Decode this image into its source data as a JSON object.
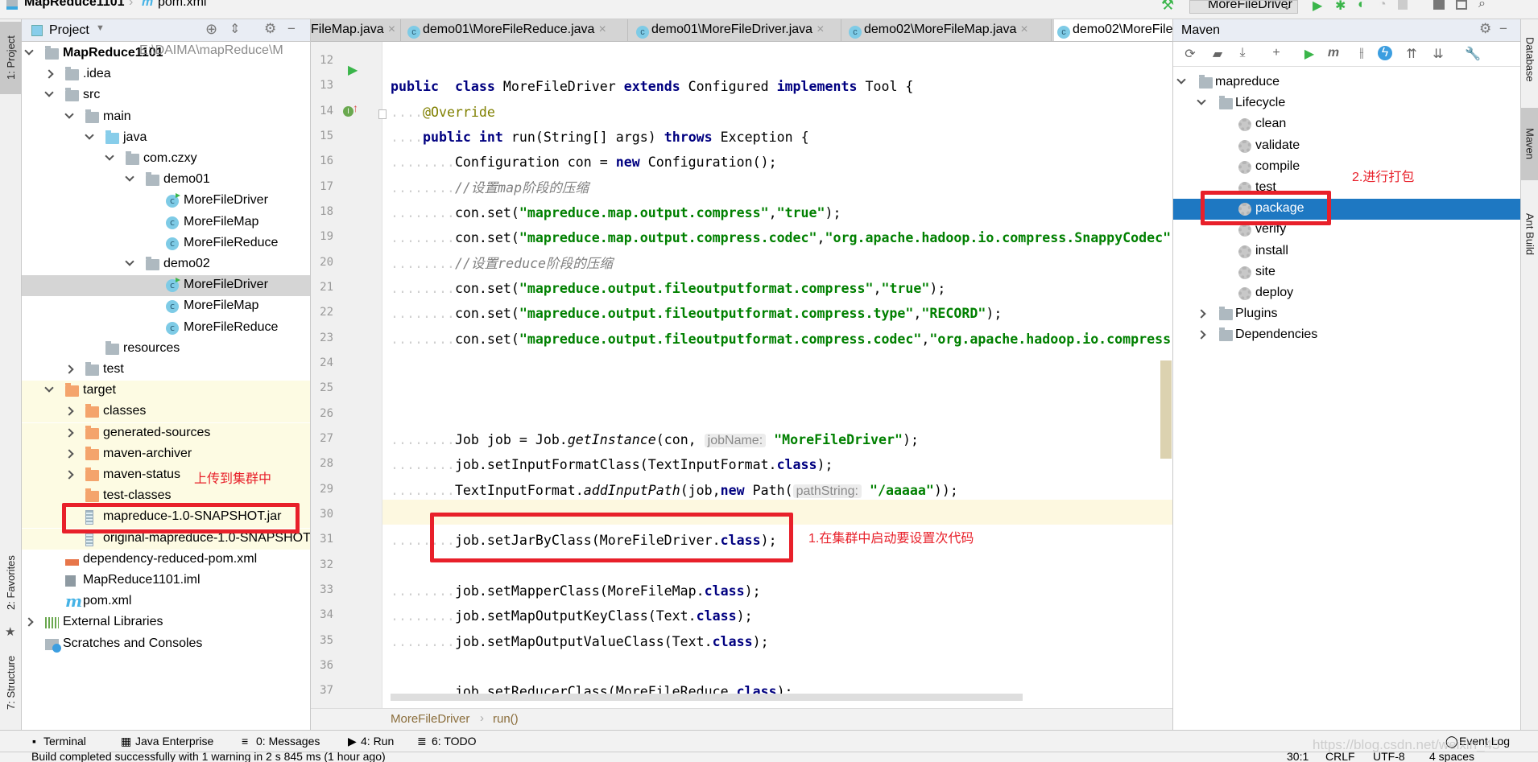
{
  "window": {
    "project": "MapReduce1101",
    "file": "pom.xml"
  },
  "toolbar": {
    "run_config": "MoreFileDriver"
  },
  "left_stripe": {
    "project": "1: Project",
    "favorites": "2: Favorites",
    "structure": "7: Structure"
  },
  "right_stripe": {
    "database": "Database",
    "maven": "Maven",
    "ant": "Ant Build"
  },
  "project": {
    "title": "Project",
    "root_path": "E:\\DAIMA\\mapReduce\\M",
    "tree": [
      {
        "label": "MapReduce1101",
        "level": 0,
        "state": "open",
        "icon": "module",
        "bold": true
      },
      {
        "label": ".idea",
        "level": 1,
        "state": "closed",
        "icon": "folder"
      },
      {
        "label": "src",
        "level": 1,
        "state": "open",
        "icon": "folder"
      },
      {
        "label": "main",
        "level": 2,
        "state": "open",
        "icon": "folder"
      },
      {
        "label": "java",
        "level": 3,
        "state": "open",
        "icon": "source-folder"
      },
      {
        "label": "com.czxy",
        "level": 4,
        "state": "open",
        "icon": "package"
      },
      {
        "label": "demo01",
        "level": 5,
        "state": "open",
        "icon": "package"
      },
      {
        "label": "MoreFileDriver",
        "level": 6,
        "icon": "class-runnable"
      },
      {
        "label": "MoreFileMap",
        "level": 6,
        "icon": "class"
      },
      {
        "label": "MoreFileReduce",
        "level": 6,
        "icon": "class"
      },
      {
        "label": "demo02",
        "level": 5,
        "state": "open",
        "icon": "package"
      },
      {
        "label": "MoreFileDriver",
        "level": 6,
        "icon": "class-runnable",
        "selected": true
      },
      {
        "label": "MoreFileMap",
        "level": 6,
        "icon": "class"
      },
      {
        "label": "MoreFileReduce",
        "level": 6,
        "icon": "class"
      },
      {
        "label": "resources",
        "level": 3,
        "icon": "resources-folder"
      },
      {
        "label": "test",
        "level": 2,
        "state": "closed",
        "icon": "folder"
      },
      {
        "label": "target",
        "level": 1,
        "state": "open",
        "icon": "excluded-folder",
        "band": true
      },
      {
        "label": "classes",
        "level": 2,
        "state": "closed",
        "icon": "excluded-folder",
        "band": true
      },
      {
        "label": "generated-sources",
        "level": 2,
        "state": "closed",
        "icon": "excluded-folder",
        "band": true
      },
      {
        "label": "maven-archiver",
        "level": 2,
        "state": "closed",
        "icon": "excluded-folder",
        "band": true
      },
      {
        "label": "maven-status",
        "level": 2,
        "state": "closed",
        "icon": "excluded-folder",
        "band": true
      },
      {
        "label": "test-classes",
        "level": 2,
        "icon": "excluded-folder",
        "band": true
      },
      {
        "label": "mapreduce-1.0-SNAPSHOT.jar",
        "level": 2,
        "icon": "jar",
        "band": true
      },
      {
        "label": "original-mapreduce-1.0-SNAPSHOT.jar",
        "level": 2,
        "icon": "jar",
        "band": true
      },
      {
        "label": "dependency-reduced-pom.xml",
        "level": 1,
        "icon": "xml"
      },
      {
        "label": "MapReduce1101.iml",
        "level": 1,
        "icon": "iml"
      },
      {
        "label": "pom.xml",
        "level": 1,
        "icon": "maven-pom"
      },
      {
        "label": "External Libraries",
        "level": 0,
        "state": "closed",
        "icon": "libraries"
      },
      {
        "label": "Scratches and Consoles",
        "level": 0,
        "icon": "scratches"
      }
    ]
  },
  "tabs": [
    {
      "label": "FileMap.java",
      "icon": "class"
    },
    {
      "label": "demo01\\MoreFileReduce.java",
      "icon": "class"
    },
    {
      "label": "demo01\\MoreFileDriver.java",
      "icon": "class-runnable"
    },
    {
      "label": "demo02\\MoreFileMap.java",
      "icon": "class"
    },
    {
      "label": "demo02\\MoreFileDriver.java",
      "icon": "class-runnable",
      "active": true
    }
  ],
  "editor": {
    "caret_line": 30,
    "lines": [
      {
        "n": "12",
        "indent": 0,
        "tokens": []
      },
      {
        "n": "13",
        "indent": 0,
        "tokens": [
          [
            "kw",
            "public"
          ],
          [
            "",
            "  "
          ],
          [
            "kw",
            "class"
          ],
          [
            "",
            " MoreFileDriver "
          ],
          [
            "kw",
            "extends"
          ],
          [
            "",
            " Configured "
          ],
          [
            "kw",
            "implements"
          ],
          [
            "",
            " Tool {"
          ]
        ]
      },
      {
        "n": "14",
        "indent": 4,
        "tokens": [
          [
            "ann",
            "@Override"
          ]
        ]
      },
      {
        "n": "15",
        "indent": 4,
        "tokens": [
          [
            "kw",
            "public"
          ],
          [
            "",
            " "
          ],
          [
            "kw",
            "int"
          ],
          [
            "",
            " run(String[] args) "
          ],
          [
            "kw",
            "throws"
          ],
          [
            "",
            " Exception {"
          ]
        ]
      },
      {
        "n": "16",
        "indent": 8,
        "tokens": [
          [
            "",
            "Configuration con = "
          ],
          [
            "kw",
            "new"
          ],
          [
            "",
            " Configuration();"
          ]
        ]
      },
      {
        "n": "17",
        "indent": 8,
        "tokens": [
          [
            "cm",
            "//设置map阶段的压缩"
          ]
        ]
      },
      {
        "n": "18",
        "indent": 8,
        "tokens": [
          [
            "",
            "con.set("
          ],
          [
            "str",
            "\"mapreduce.map.output.compress\""
          ],
          [
            "",
            ","
          ],
          [
            "str",
            "\"true\""
          ],
          [
            "",
            ");"
          ]
        ]
      },
      {
        "n": "19",
        "indent": 8,
        "tokens": [
          [
            "",
            "con.set("
          ],
          [
            "str",
            "\"mapreduce.map.output.compress.codec\""
          ],
          [
            "",
            ","
          ],
          [
            "str",
            "\"org.apache.hadoop.io.compress.SnappyCodec\""
          ],
          [
            "",
            ");"
          ]
        ]
      },
      {
        "n": "20",
        "indent": 8,
        "tokens": [
          [
            "cm",
            "//设置reduce阶段的压缩"
          ]
        ]
      },
      {
        "n": "21",
        "indent": 8,
        "tokens": [
          [
            "",
            "con.set("
          ],
          [
            "str",
            "\"mapreduce.output.fileoutputformat.compress\""
          ],
          [
            "",
            ","
          ],
          [
            "str",
            "\"true\""
          ],
          [
            "",
            ");"
          ]
        ]
      },
      {
        "n": "22",
        "indent": 8,
        "tokens": [
          [
            "",
            "con.set("
          ],
          [
            "str",
            "\"mapreduce.output.fileoutputformat.compress.type\""
          ],
          [
            "",
            ","
          ],
          [
            "str",
            "\"RECORD\""
          ],
          [
            "",
            ");"
          ]
        ]
      },
      {
        "n": "23",
        "indent": 8,
        "tokens": [
          [
            "",
            "con.set("
          ],
          [
            "str",
            "\"mapreduce.output.fileoutputformat.compress.codec\""
          ],
          [
            "",
            ","
          ],
          [
            "str",
            "\"org.apache.hadoop.io.compress"
          ]
        ]
      },
      {
        "n": "24",
        "indent": 0,
        "tokens": []
      },
      {
        "n": "25",
        "indent": 0,
        "tokens": []
      },
      {
        "n": "26",
        "indent": 0,
        "tokens": []
      },
      {
        "n": "27",
        "indent": 8,
        "tokens": [
          [
            "",
            "Job job = Job."
          ],
          [
            "it",
            "getInstance"
          ],
          [
            "",
            "(con, "
          ],
          [
            "hint",
            "jobName:"
          ],
          [
            "str",
            "\"MoreFileDriver\""
          ],
          [
            "",
            ");"
          ]
        ]
      },
      {
        "n": "28",
        "indent": 8,
        "tokens": [
          [
            "",
            "job.setInputFormatClass(TextInputFormat."
          ],
          [
            "kw",
            "class"
          ],
          [
            "",
            ");"
          ]
        ]
      },
      {
        "n": "29",
        "indent": 8,
        "tokens": [
          [
            "",
            "TextInputFormat."
          ],
          [
            "it",
            "addInputPath"
          ],
          [
            "",
            "(job,"
          ],
          [
            "kw",
            "new"
          ],
          [
            "",
            " Path("
          ],
          [
            "hint",
            "pathString:"
          ],
          [
            "str",
            "\"/aaaaa\""
          ],
          [
            "",
            "));"
          ]
        ]
      },
      {
        "n": "30",
        "indent": 0,
        "tokens": []
      },
      {
        "n": "31",
        "indent": 8,
        "tokens": [
          [
            "",
            "job.setJarByClass(MoreFileDriver."
          ],
          [
            "kw",
            "class"
          ],
          [
            "",
            ");"
          ]
        ]
      },
      {
        "n": "32",
        "indent": 0,
        "tokens": []
      },
      {
        "n": "33",
        "indent": 8,
        "tokens": [
          [
            "",
            "job.setMapperClass(MoreFileMap."
          ],
          [
            "kw",
            "class"
          ],
          [
            "",
            ");"
          ]
        ]
      },
      {
        "n": "34",
        "indent": 8,
        "tokens": [
          [
            "",
            "job.setMapOutputKeyClass(Text."
          ],
          [
            "kw",
            "class"
          ],
          [
            "",
            ");"
          ]
        ]
      },
      {
        "n": "35",
        "indent": 8,
        "tokens": [
          [
            "",
            "job.setMapOutputValueClass(Text."
          ],
          [
            "kw",
            "class"
          ],
          [
            "",
            ");"
          ]
        ]
      },
      {
        "n": "36",
        "indent": 0,
        "tokens": []
      },
      {
        "n": "37",
        "indent": 8,
        "tokens": [
          [
            "",
            "job.setReducerClass(MoreFileReduce."
          ],
          [
            "kw",
            "class"
          ],
          [
            "",
            ");"
          ]
        ]
      }
    ],
    "breadcrumb": {
      "class": "MoreFileDriver",
      "method": "run()"
    }
  },
  "maven": {
    "title": "Maven",
    "tree": [
      {
        "label": "mapreduce",
        "level": 0,
        "state": "open",
        "icon": "maven-project"
      },
      {
        "label": "Lifecycle",
        "level": 1,
        "state": "open",
        "icon": "lifecycle-folder"
      },
      {
        "label": "clean",
        "level": 2,
        "icon": "gear"
      },
      {
        "label": "validate",
        "level": 2,
        "icon": "gear"
      },
      {
        "label": "compile",
        "level": 2,
        "icon": "gear"
      },
      {
        "label": "test",
        "level": 2,
        "icon": "gear"
      },
      {
        "label": "package",
        "level": 2,
        "icon": "gear",
        "selected": true
      },
      {
        "label": "verify",
        "level": 2,
        "icon": "gear"
      },
      {
        "label": "install",
        "level": 2,
        "icon": "gear"
      },
      {
        "label": "site",
        "level": 2,
        "icon": "gear"
      },
      {
        "label": "deploy",
        "level": 2,
        "icon": "gear"
      },
      {
        "label": "Plugins",
        "level": 1,
        "state": "closed",
        "icon": "plugins-folder"
      },
      {
        "label": "Dependencies",
        "level": 1,
        "state": "closed",
        "icon": "dependencies-folder"
      }
    ],
    "toolbar_icons": [
      "refresh-icon",
      "generate-sources-icon",
      "download-icon",
      "add-icon",
      "run-icon",
      "execute-goal-icon",
      "skip-tests-icon",
      "offline-icon",
      "expand-all-icon",
      "collapse-all-icon",
      "settings-wrench-icon"
    ]
  },
  "annotations": {
    "upload": "上传到集群中",
    "set_jar": "1.在集群中启动要设置次代码",
    "package": "2.进行打包"
  },
  "bottom_tools": {
    "terminal": "Terminal",
    "java_enterprise": "Java Enterprise",
    "messages": "0: Messages",
    "run": "4: Run",
    "todo": "6: TODO",
    "event_log": "Event Log"
  },
  "status": {
    "message": "Build completed successfully with 1 warning in 2 s 845 ms (1 hour ago)",
    "position": "30:1",
    "line_separator": "CRLF",
    "encoding": "UTF-8",
    "indent": "4 spaces"
  },
  "watermark": "https://blog.csdn.net/weixin_45",
  "colors": {
    "accent_selection": "#1e78c2",
    "annotation_red": "#e8202a",
    "keyword": "#000080",
    "string": "#008000",
    "excluded_band": "#fdfbe3"
  }
}
